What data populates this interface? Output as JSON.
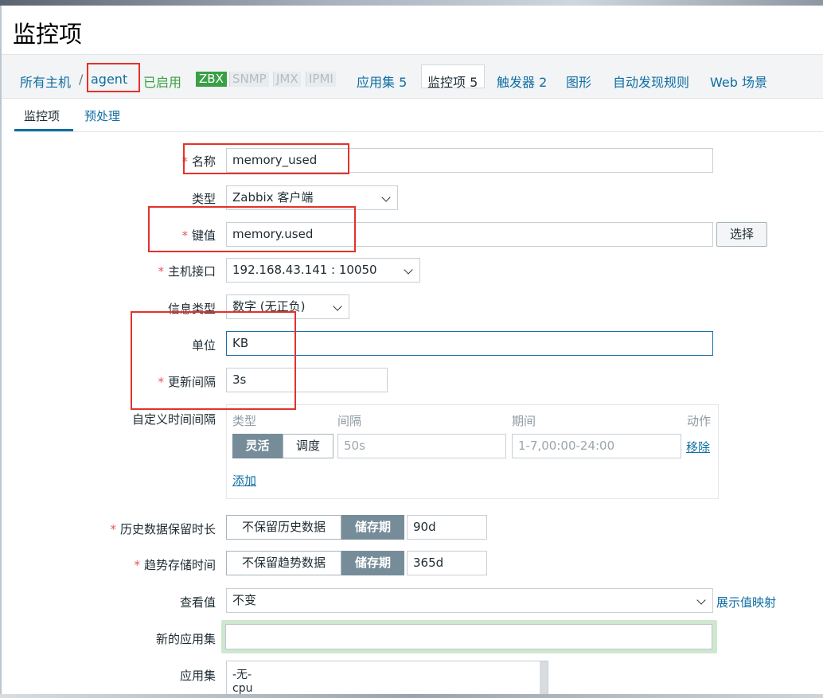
{
  "page_title": "监控项",
  "nav": {
    "all_hosts": "所有主机",
    "separator": "/",
    "host": "agent",
    "status": "已启用",
    "badges": {
      "zbx": "ZBX",
      "snmp": "SNMP",
      "jmx": "JMX",
      "ipmi": "IPMI"
    },
    "applications": "应用集 5",
    "items": "监控项 5",
    "triggers": "触发器 2",
    "graphs": "图形",
    "discovery": "自动发现规则",
    "web": "Web 场景"
  },
  "tabs": {
    "item": "监控项",
    "preprocessing": "预处理"
  },
  "form": {
    "required_mark": "*",
    "name": {
      "label": "名称",
      "value": "memory_used"
    },
    "type": {
      "label": "类型",
      "value": "Zabbix 客户端"
    },
    "key": {
      "label": "键值",
      "value": "memory.used",
      "select_button": "选择"
    },
    "interface": {
      "label": "主机接口",
      "value": "192.168.43.141 : 10050"
    },
    "info_type": {
      "label": "信息类型",
      "value": "数字 (无正负)"
    },
    "units": {
      "label": "单位",
      "value": "KB"
    },
    "update_interval": {
      "label": "更新间隔",
      "value": "3s"
    },
    "custom_intervals": {
      "label": "自定义时间间隔",
      "col_type": "类型",
      "col_interval": "间隔",
      "col_period": "期间",
      "col_action": "动作",
      "flexible": "灵活",
      "scheduling": "调度",
      "interval_placeholder": "50s",
      "period_placeholder": "1-7,00:00-24:00",
      "remove": "移除",
      "add": "添加"
    },
    "history": {
      "label": "历史数据保留时长",
      "no_keep": "不保留历史数据",
      "storage": "储存期",
      "value": "90d"
    },
    "trends": {
      "label": "趋势存储时间",
      "no_keep": "不保留趋势数据",
      "storage": "储存期",
      "value": "365d"
    },
    "show_value": {
      "label": "查看值",
      "value": "不变",
      "link": "展示值映射"
    },
    "new_application": {
      "label": "新的应用集",
      "value": ""
    },
    "applications": {
      "label": "应用集",
      "options": [
        "-无-",
        "cpu"
      ]
    }
  },
  "colors": {
    "link": "#0f6ea3",
    "enabled": "#3aa046",
    "required": "#e45959",
    "segment_active": "#768d99",
    "annotation": "#e3322b"
  }
}
